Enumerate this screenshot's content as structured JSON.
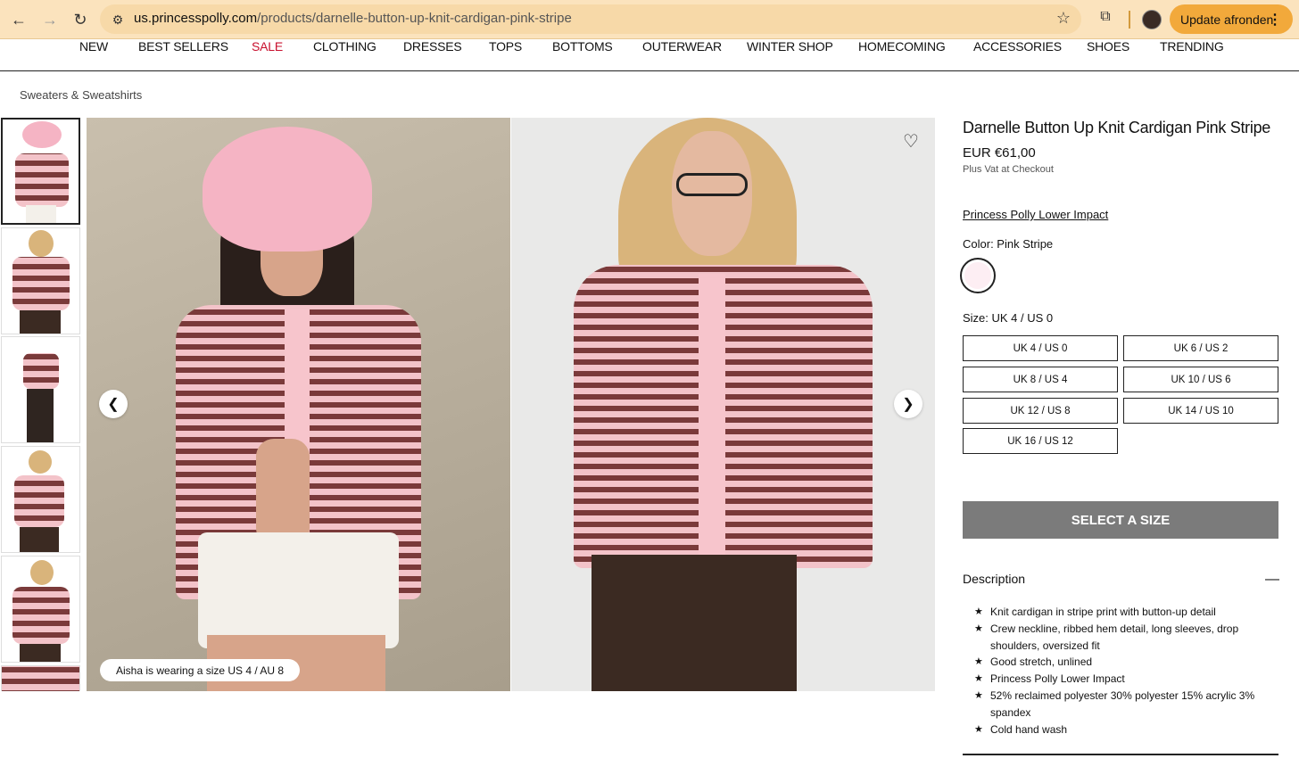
{
  "browser": {
    "url_domain": "us.princesspolly.com",
    "url_path": "/products/darnelle-button-up-knit-cardigan-pink-stripe",
    "update_label": "Update afronden"
  },
  "nav": {
    "items": [
      "NEW",
      "BEST SELLERS",
      "SALE",
      "CLOTHING",
      "DRESSES",
      "TOPS",
      "BOTTOMS",
      "OUTERWEAR",
      "WINTER SHOP",
      "HOMECOMING",
      "ACCESSORIES",
      "SHOES",
      "TRENDING"
    ],
    "sale_color": "#c8102e"
  },
  "breadcrumb": "Sweaters & Sweatshirts",
  "gallery": {
    "prev": "❮",
    "next": "❯",
    "model_note": "Aisha is wearing a size US 4 / AU 8"
  },
  "product": {
    "title": "Darnelle Button Up Knit Cardigan Pink Stripe",
    "price": "EUR  €61,00",
    "vat_note": "Plus Vat at Checkout",
    "impact_link": "Princess Polly Lower Impact",
    "color_label": "Color:  Pink Stripe",
    "size_label": "Size: UK 4 / US 0",
    "sizes": [
      "UK 4 / US 0",
      "UK 6 / US 2",
      "UK 8 / US 4",
      "UK 10 / US 6",
      "UK 12 / US 8",
      "UK 14 / US 10",
      "UK 16 / US 12"
    ],
    "select_button": "SELECT A SIZE",
    "swatch_color": "#fdeef3"
  },
  "description": {
    "heading": "Description",
    "toggle": "—",
    "bullets": [
      "Knit cardigan in stripe print with button-up detail",
      "Crew neckline, ribbed hem detail, long sleeves, drop shoulders, oversized fit",
      "Good stretch, unlined",
      "Princess Polly Lower Impact",
      "52% reclaimed polyester 30% polyester 15% acrylic 3% spandex",
      "Cold hand wash"
    ]
  }
}
